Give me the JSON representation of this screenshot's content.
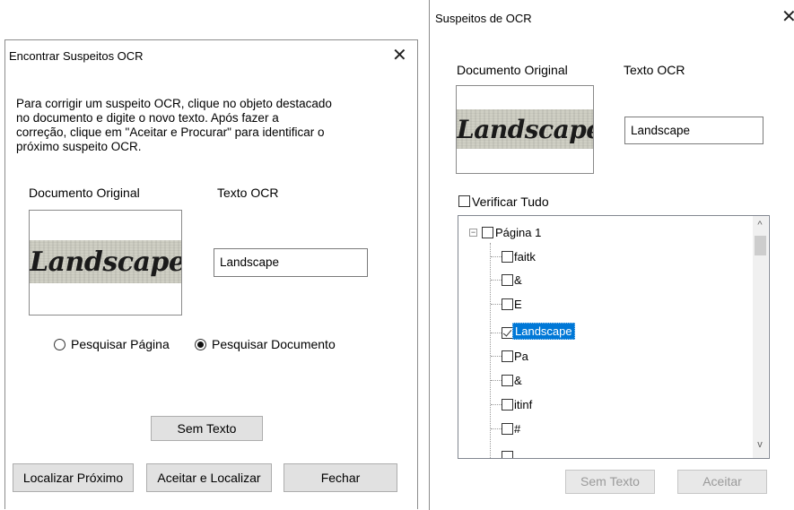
{
  "find_dialog": {
    "title": "Encontrar Suspeitos OCR",
    "close_glyph": "✕",
    "instructions": [
      "Para corrigir um suspeito OCR, clique no objeto destacado",
      "no documento e digite o novo texto. Após fazer a",
      "correção, clique em \"Aceitar e Procurar\" para identificar o",
      "próximo suspeito OCR."
    ],
    "original_label": "Documento Original",
    "ocr_label": "Texto OCR",
    "image_word": "Landscape",
    "ocr_value": "Landscape",
    "radio_page": "Pesquisar Página",
    "radio_document": "Pesquisar Documento",
    "selected_search": "Pesquisar Documento",
    "no_text_button": "Sem Texto",
    "find_next_button": "Localizar Próximo",
    "accept_find_button": "Aceitar e Localizar",
    "close_button": "Fechar"
  },
  "suspects_dialog": {
    "title": "Suspeitos de OCR",
    "close_glyph": "✕",
    "original_label": "Documento Original",
    "ocr_label": "Texto OCR",
    "image_word": "Landscape",
    "ocr_value": "Landscape",
    "verify_all_label": "Verificar Tudo",
    "verify_all_checked": false,
    "tree": {
      "root_label": "Página  1",
      "root_expander": "−",
      "items": [
        {
          "label": "faitk",
          "checked": false,
          "selected": false
        },
        {
          "label": "&",
          "checked": false,
          "selected": false
        },
        {
          "label": "E",
          "checked": false,
          "selected": false
        },
        {
          "label": "Landscape",
          "checked": true,
          "selected": true
        },
        {
          "label": "Pa",
          "checked": false,
          "selected": false
        },
        {
          "label": "&",
          "checked": false,
          "selected": false
        },
        {
          "label": "itinf",
          "checked": false,
          "selected": false
        },
        {
          "label": "#",
          "checked": false,
          "selected": false
        }
      ]
    },
    "scroll_up_glyph": "^",
    "scroll_down_glyph": "v",
    "no_text_button": "Sem Texto",
    "accept_button": "Aceitar"
  }
}
